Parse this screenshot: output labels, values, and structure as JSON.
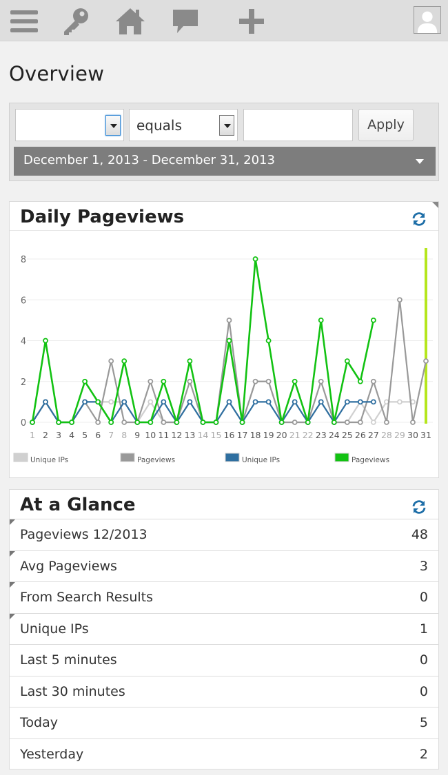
{
  "topbar": {
    "icons": [
      "menu-icon",
      "key-icon",
      "home-icon",
      "comment-icon",
      "plus-icon"
    ],
    "avatar_icon": "user-avatar-icon"
  },
  "page": {
    "title": "Overview"
  },
  "filter": {
    "field_select": "",
    "operator_select": "equals",
    "value_input": "",
    "apply_label": "Apply",
    "date_range": "December 1, 2013 - December 31, 2013"
  },
  "chart_widget": {
    "title": "Daily Pageviews",
    "refresh_icon": "refresh-icon"
  },
  "chart_data": {
    "type": "line",
    "x": [
      1,
      2,
      3,
      4,
      5,
      6,
      7,
      8,
      9,
      10,
      11,
      12,
      13,
      14,
      15,
      16,
      17,
      18,
      19,
      20,
      21,
      22,
      23,
      24,
      25,
      26,
      27,
      28,
      29,
      30,
      31
    ],
    "x_tick_colors": [
      "#aaaaaa",
      "#555555",
      "#555555",
      "#555555",
      "#555555",
      "#555555",
      "#aaaaaa",
      "#aaaaaa",
      "#555555",
      "#555555",
      "#555555",
      "#555555",
      "#555555",
      "#aaaaaa",
      "#aaaaaa",
      "#555555",
      "#555555",
      "#555555",
      "#555555",
      "#555555",
      "#aaaaaa",
      "#aaaaaa",
      "#555555",
      "#555555",
      "#555555",
      "#555555",
      "#555555",
      "#aaaaaa",
      "#aaaaaa",
      "#555555",
      "#555555"
    ],
    "yticks": [
      0,
      2,
      4,
      6,
      8
    ],
    "ylim": [
      0,
      8.5
    ],
    "grid": true,
    "series": [
      {
        "name": "Unique IPs",
        "color": "#d0d0d0",
        "values": [
          0,
          1,
          0,
          0,
          1,
          1,
          1,
          1,
          0,
          1,
          0,
          0,
          1,
          0,
          0,
          1,
          0,
          2,
          2,
          0,
          0,
          0,
          1,
          0,
          0,
          1,
          0,
          1,
          1,
          1,
          null
        ]
      },
      {
        "name": "Pageviews",
        "color": "#999999",
        "values": [
          0,
          1,
          0,
          0,
          1,
          0,
          3,
          0,
          0,
          2,
          0,
          0,
          2,
          0,
          0,
          5,
          0,
          2,
          2,
          0,
          0,
          0,
          2,
          0,
          0,
          0,
          2,
          0,
          6,
          0,
          3
        ]
      },
      {
        "name": "Unique IPs",
        "color": "#2f6fa0",
        "values": [
          0,
          1,
          0,
          0,
          1,
          1,
          0,
          1,
          0,
          0,
          1,
          0,
          1,
          0,
          0,
          1,
          0,
          1,
          1,
          0,
          1,
          0,
          1,
          0,
          1,
          1,
          1,
          null,
          null,
          null,
          null
        ]
      },
      {
        "name": "Pageviews",
        "color": "#12c212",
        "values": [
          0,
          4,
          0,
          0,
          2,
          1,
          0,
          3,
          0,
          0,
          2,
          0,
          3,
          0,
          0,
          4,
          0,
          8,
          4,
          0,
          2,
          0,
          5,
          0,
          3,
          2,
          5,
          null,
          null,
          null,
          null
        ]
      }
    ],
    "today_marker_color": "#b5e61d",
    "legend_placement": "bottom"
  },
  "glance_widget": {
    "title": "At a Glance",
    "refresh_icon": "refresh-icon",
    "rows": [
      {
        "label": "Pageviews 12/2013",
        "value": "48",
        "marked": true
      },
      {
        "label": "Avg Pageviews",
        "value": "3",
        "marked": true
      },
      {
        "label": "From Search Results",
        "value": "0",
        "marked": true
      },
      {
        "label": "Unique IPs",
        "value": "1",
        "marked": true
      },
      {
        "label": "Last 5 minutes",
        "value": "0",
        "marked": false
      },
      {
        "label": "Last 30 minutes",
        "value": "0",
        "marked": false
      },
      {
        "label": "Today",
        "value": "5",
        "marked": false
      },
      {
        "label": "Yesterday",
        "value": "2",
        "marked": false
      }
    ]
  }
}
